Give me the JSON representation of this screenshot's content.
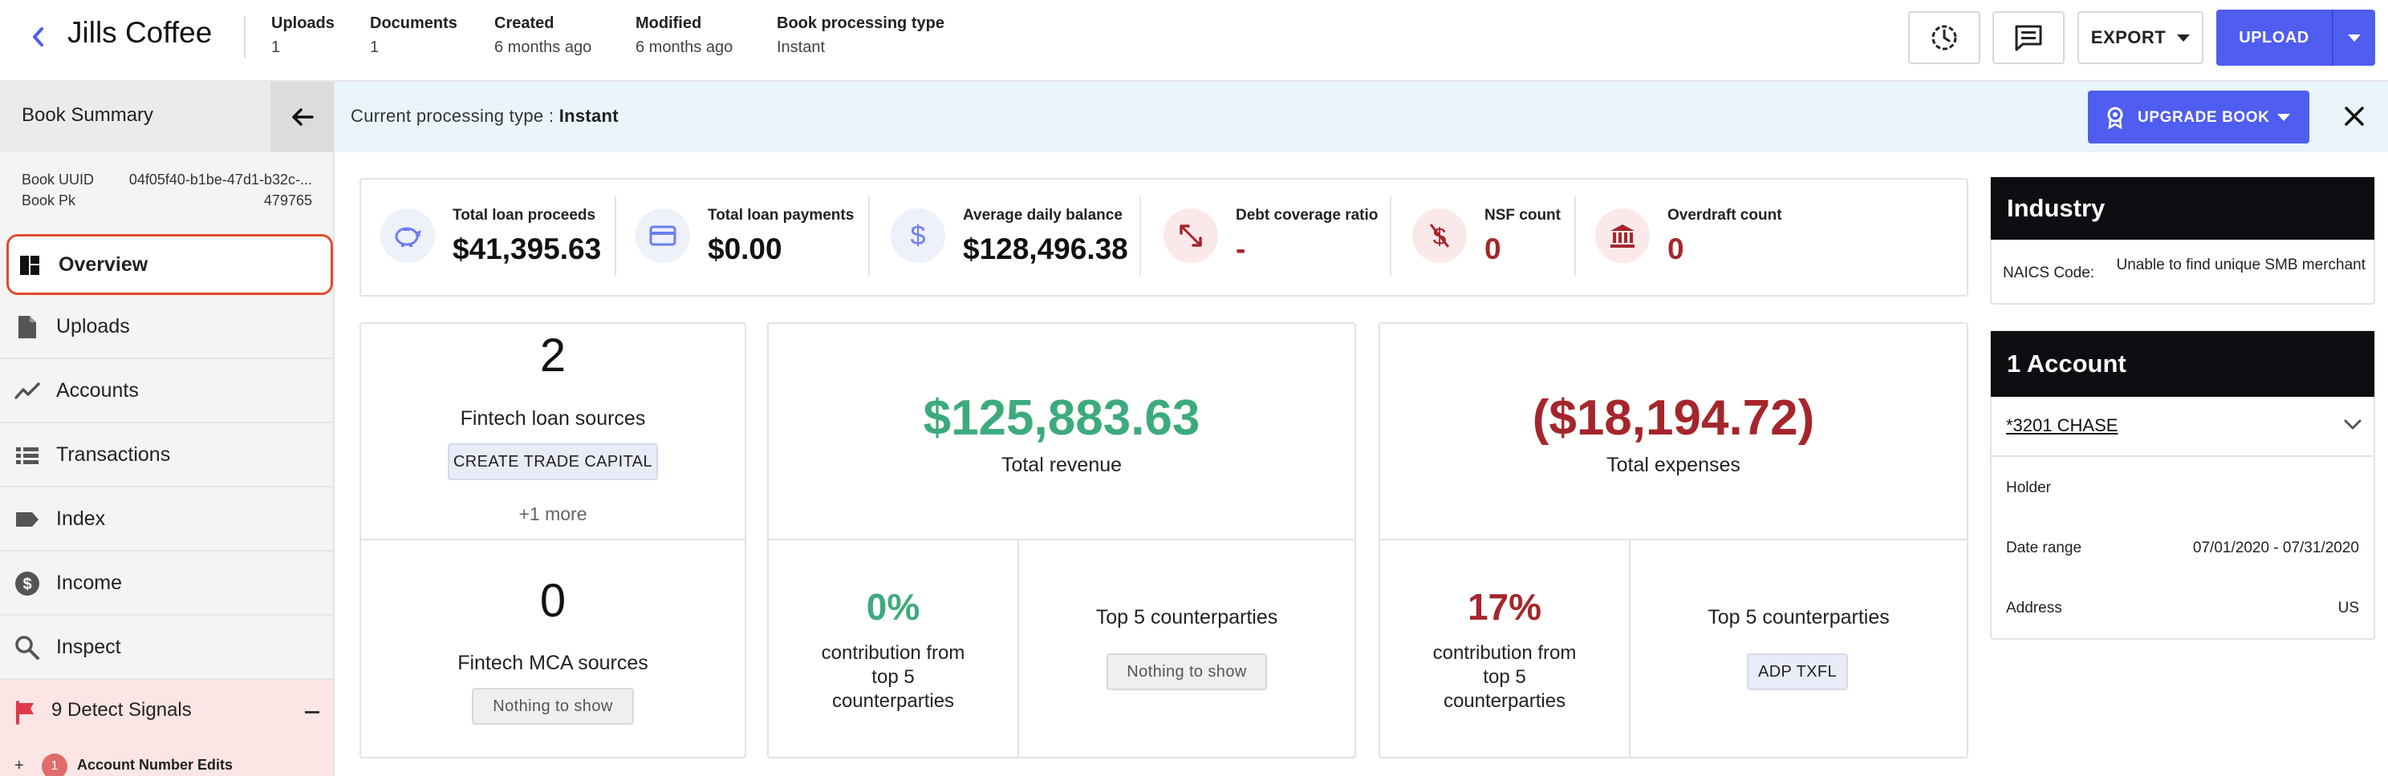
{
  "header": {
    "title": "Jills Coffee",
    "meta": [
      {
        "label": "Uploads",
        "value": "1"
      },
      {
        "label": "Documents",
        "value": "1"
      },
      {
        "label": "Created",
        "value": "6 months ago"
      },
      {
        "label": "Modified",
        "value": "6 months ago"
      },
      {
        "label": "Book processing type",
        "value": "Instant"
      }
    ],
    "export_label": "EXPORT",
    "upload_label": "UPLOAD"
  },
  "sidebar": {
    "title": "Book Summary",
    "book_uuid_label": "Book UUID",
    "book_uuid_value": "04f05f40-b1be-47d1-b32c-...",
    "book_pk_label": "Book Pk",
    "book_pk_value": "479765",
    "items": [
      {
        "label": "Overview",
        "icon": "dashboard-icon",
        "active": true
      },
      {
        "label": "Uploads",
        "icon": "file-icon"
      },
      {
        "label": "Accounts",
        "icon": "trend-icon"
      },
      {
        "label": "Transactions",
        "icon": "list-icon"
      },
      {
        "label": "Index",
        "icon": "tag-icon"
      },
      {
        "label": "Income",
        "icon": "dollar-circle-icon"
      },
      {
        "label": "Inspect",
        "icon": "search-icon"
      }
    ],
    "signals_label": "9 Detect Signals",
    "signal_sub_count": "1",
    "signal_sub_label": "Account Number Edits"
  },
  "banner": {
    "text": "Current processing type : ",
    "value": "Instant",
    "upgrade_label": "UPGRADE BOOK"
  },
  "stats": [
    {
      "label": "Total loan proceeds",
      "value": "$41,395.63",
      "icon": "piggy-bank-icon",
      "tone": "blue"
    },
    {
      "label": "Total loan payments",
      "value": "$0.00",
      "icon": "credit-card-icon",
      "tone": "blue"
    },
    {
      "label": "Average daily balance",
      "value": "$128,496.38",
      "icon": "dollar-icon",
      "tone": "blue"
    },
    {
      "label": "Debt coverage ratio",
      "value": "-",
      "icon": "expand-arrows-icon",
      "tone": "red"
    },
    {
      "label": "NSF count",
      "value": "0",
      "icon": "no-money-icon",
      "tone": "red"
    },
    {
      "label": "Overdraft count",
      "value": "0",
      "icon": "bank-icon",
      "tone": "red"
    }
  ],
  "fintech": {
    "loan_count": "2",
    "loan_label": "Fintech loan sources",
    "loan_chip": "CREATE TRADE CAPITAL",
    "more": "+1 more",
    "mca_count": "0",
    "mca_label": "Fintech MCA sources",
    "mca_chip": "Nothing to show"
  },
  "revenue": {
    "value": "$125,883.63",
    "label": "Total revenue",
    "pct": "0%",
    "pct_label": "contribution from top 5 counterparties",
    "top_label": "Top 5 counterparties",
    "chip": "Nothing to show"
  },
  "expenses": {
    "value": "($18,194.72)",
    "label": "Total expenses",
    "pct": "17%",
    "pct_label": "contribution from top 5 counterparties",
    "top_label": "Top 5 counterparties",
    "chip": "ADP TXFL"
  },
  "industry": {
    "title": "Industry",
    "naics_label": "NAICS Code:",
    "naics_value": "Unable to find unique SMB merchant"
  },
  "account": {
    "title": "1 Account",
    "name": "*3201 CHASE",
    "holder_label": "Holder",
    "holder_value": "",
    "date_label": "Date range",
    "date_value": "07/01/2020 - 07/31/2020",
    "address_label": "Address",
    "address_value": "US"
  },
  "colors": {
    "accent": "#4f5df0",
    "positive": "#3daa7e",
    "negative": "#a4262c",
    "active_outline": "#e24a2f"
  }
}
